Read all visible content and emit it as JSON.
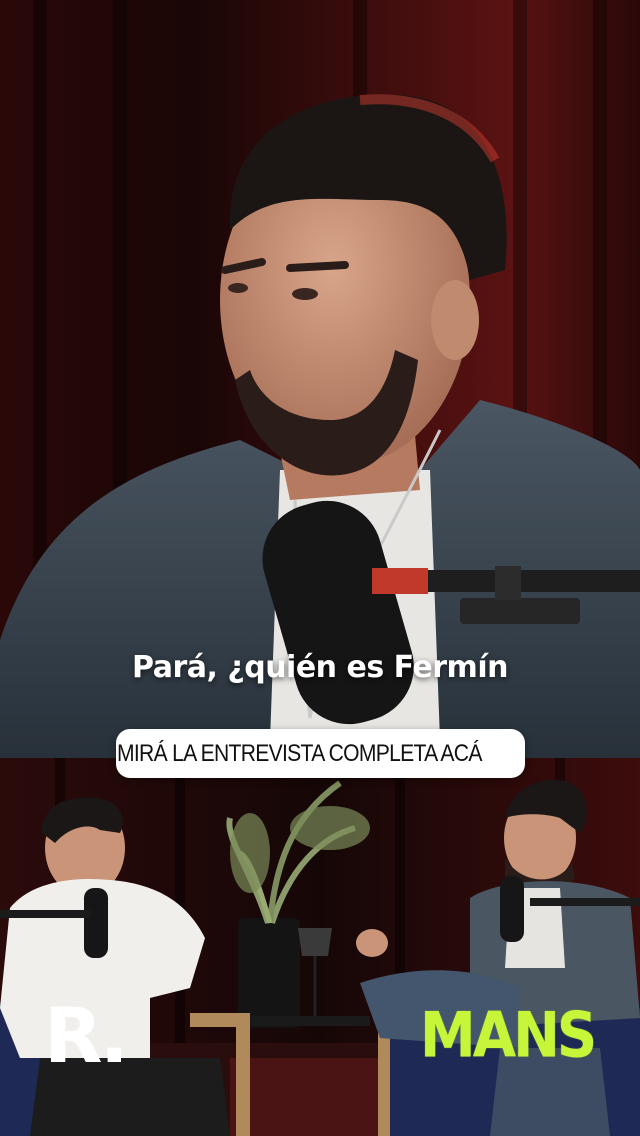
{
  "subtitle": "Pará, ¿quién es Fermín",
  "cta": {
    "label": "MIRÁ LA ENTREVISTA COMPLETA ACÁ",
    "icon": "link-icon"
  },
  "brands": {
    "left_logo": "R.",
    "right_logo": "MANS",
    "right_logo_color": "#c6f53a"
  },
  "colors": {
    "curtain": "#3a0d0d",
    "background": "#0e0a0a"
  }
}
